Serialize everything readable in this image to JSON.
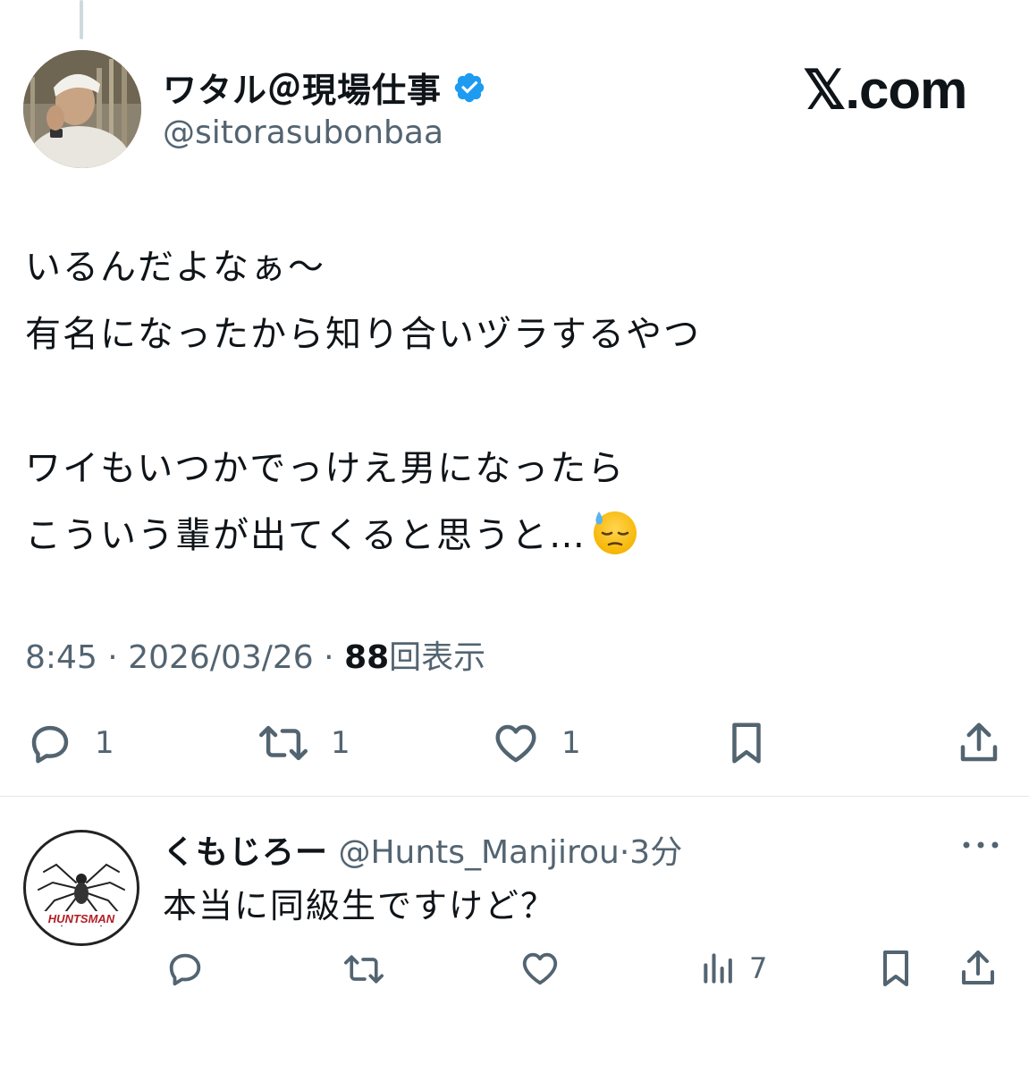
{
  "author": {
    "display_name": "ワタル＠現場仕事",
    "handle": "@sitorasubonbaa",
    "verified": true,
    "avatar_icon": "profile-photo"
  },
  "brand": "𝕏.com",
  "post": {
    "lines": [
      "いるんだよなぁ〜",
      "有名になったから知り合いヅラするやつ",
      "",
      "ワイもいつかでっけえ男になったら",
      "こういう輩が出てくると思うと…"
    ],
    "emoji": "downcast-face-with-sweat-icon"
  },
  "meta": {
    "time": "8:45",
    "sep": "·",
    "date": "2026/03/26",
    "views_count": "88",
    "views_label": "回表示"
  },
  "actions": {
    "reply_count": "1",
    "repost_count": "1",
    "like_count": "1"
  },
  "reply": {
    "display_name": "くもじろー",
    "handle": "@Hunts_Manjirou",
    "sep": "·",
    "time": "3分",
    "text": "本当に同級生ですけど？",
    "avatar_text": "HUNTSMAN",
    "views_count": "7"
  },
  "colors": {
    "text": "#0f1419",
    "secondary": "#536471",
    "verified": "#1d9bf0",
    "divider": "#e1e8ed"
  }
}
